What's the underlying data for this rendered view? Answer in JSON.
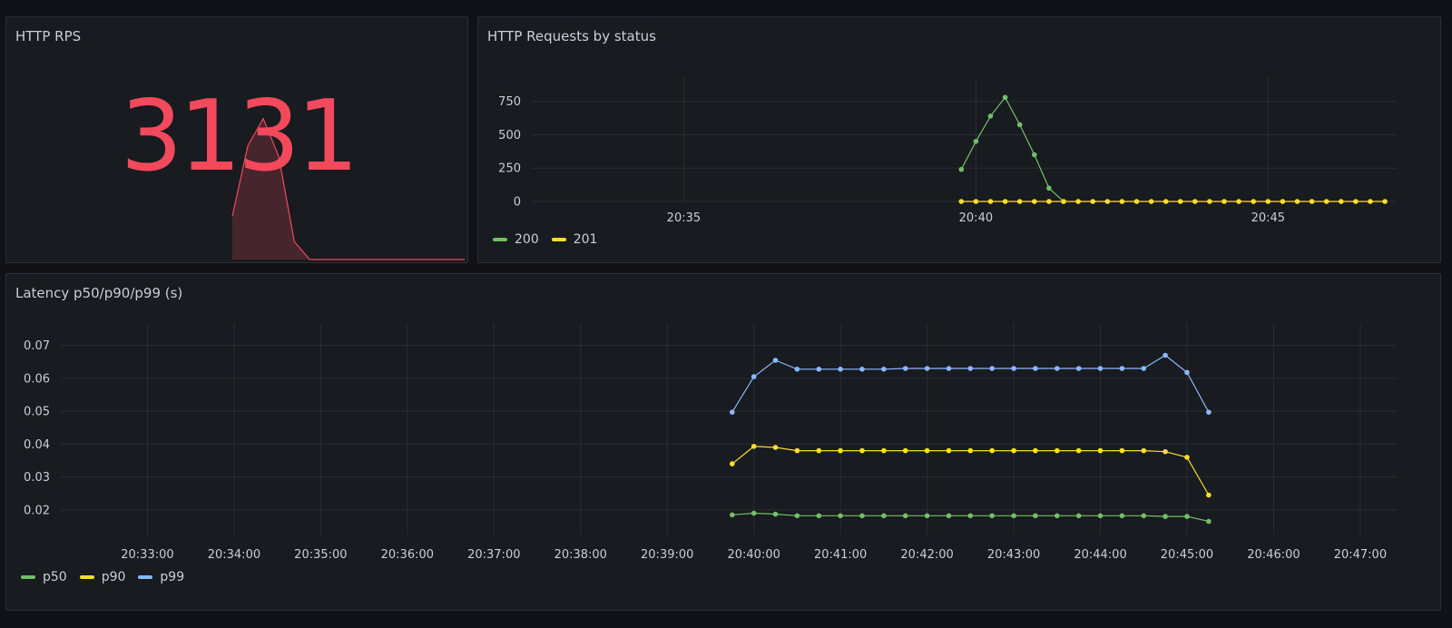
{
  "panels": {
    "rps": {
      "title": "HTTP RPS",
      "value": "3131",
      "color": "#f2495c"
    },
    "status": {
      "title": "HTTP Requests by status"
    },
    "latency": {
      "title": "Latency p50/p90/p99 (s)"
    }
  },
  "chart_data": [
    {
      "type": "area",
      "panel": "rps",
      "title": "",
      "x": [
        0,
        1,
        2,
        3,
        4,
        5,
        6,
        7,
        8,
        9,
        10,
        11,
        12,
        13,
        14,
        15
      ],
      "values": [
        240,
        630,
        780,
        570,
        100,
        0,
        0,
        0,
        0,
        0,
        0,
        0,
        0,
        0,
        0,
        0
      ],
      "ylim": [
        0,
        1050
      ],
      "color": "#f2495c"
    },
    {
      "type": "line",
      "panel": "status",
      "title": "HTTP Requests by status",
      "xticks": [
        "20:35",
        "20:40",
        "20:45"
      ],
      "xtick_minutes": [
        35,
        40,
        45
      ],
      "xlim": [
        32.4,
        47.2
      ],
      "yticks": [
        0,
        250,
        500,
        750
      ],
      "ylim": [
        0,
        850
      ],
      "grid": true,
      "legend": "bottom-left",
      "series": [
        {
          "name": "200",
          "color": "#73bf69",
          "x": [
            39.75,
            40.0,
            40.25,
            40.5,
            40.75,
            41.0,
            41.25,
            41.5
          ],
          "values": [
            240,
            450,
            640,
            780,
            575,
            350,
            100,
            0
          ]
        },
        {
          "name": "201",
          "color": "#fade2a",
          "x": [
            39.75,
            40.0,
            40.25,
            40.5,
            40.75,
            41.0,
            41.25,
            41.5,
            41.75,
            42.0,
            42.25,
            42.5,
            42.75,
            43.0,
            43.25,
            43.5,
            43.75,
            44.0,
            44.25,
            44.5,
            44.75,
            45.0,
            45.25,
            45.5,
            45.75,
            46.0,
            46.25,
            46.5,
            46.75,
            47.0
          ],
          "values": [
            0,
            0,
            0,
            0,
            0,
            0,
            0,
            0,
            0,
            0,
            0,
            0,
            0,
            0,
            0,
            0,
            0,
            0,
            0,
            0,
            0,
            0,
            0,
            0,
            0,
            0,
            0,
            0,
            0,
            0
          ]
        }
      ]
    },
    {
      "type": "line",
      "panel": "latency",
      "title": "Latency p50/p90/p99 (s)",
      "xticks": [
        "20:33:00",
        "20:34:00",
        "20:35:00",
        "20:36:00",
        "20:37:00",
        "20:38:00",
        "20:39:00",
        "20:40:00",
        "20:41:00",
        "20:42:00",
        "20:43:00",
        "20:44:00",
        "20:45:00",
        "20:46:00",
        "20:47:00"
      ],
      "xtick_minutes": [
        33,
        34,
        35,
        36,
        37,
        38,
        39,
        40,
        41,
        42,
        43,
        44,
        45,
        46,
        47
      ],
      "xlim": [
        32.0,
        47.42
      ],
      "yticks": [
        0.02,
        0.03,
        0.04,
        0.05,
        0.06,
        0.07
      ],
      "ylim": [
        0.0125,
        0.0735
      ],
      "grid": true,
      "legend": "bottom-left",
      "series": [
        {
          "name": "p50",
          "color": "#73bf69",
          "x": [
            39.75,
            40.0,
            40.25,
            40.5,
            40.75,
            41.0,
            41.25,
            41.5,
            41.75,
            42.0,
            42.25,
            42.5,
            42.75,
            43.0,
            43.25,
            43.5,
            43.75,
            44.0,
            44.25,
            44.5,
            44.75,
            45.0,
            45.25
          ],
          "values": [
            0.0185,
            0.019,
            0.0187,
            0.0182,
            0.0182,
            0.0182,
            0.0182,
            0.0182,
            0.0182,
            0.0182,
            0.0182,
            0.0182,
            0.0182,
            0.0182,
            0.0182,
            0.0182,
            0.0182,
            0.0182,
            0.0182,
            0.0182,
            0.018,
            0.018,
            0.0165
          ]
        },
        {
          "name": "p90",
          "color": "#fade2a",
          "x": [
            39.75,
            40.0,
            40.25,
            40.5,
            40.75,
            41.0,
            41.25,
            41.5,
            41.75,
            42.0,
            42.25,
            42.5,
            42.75,
            43.0,
            43.25,
            43.5,
            43.75,
            44.0,
            44.25,
            44.5,
            44.75,
            45.0,
            45.25
          ],
          "values": [
            0.034,
            0.0393,
            0.039,
            0.038,
            0.038,
            0.038,
            0.038,
            0.038,
            0.038,
            0.038,
            0.038,
            0.038,
            0.038,
            0.038,
            0.038,
            0.038,
            0.038,
            0.038,
            0.038,
            0.038,
            0.0377,
            0.036,
            0.0245
          ]
        },
        {
          "name": "p99",
          "color": "#8ab8ff",
          "x": [
            39.75,
            40.0,
            40.25,
            40.5,
            40.75,
            41.0,
            41.25,
            41.5,
            41.75,
            42.0,
            42.25,
            42.5,
            42.75,
            43.0,
            43.25,
            43.5,
            43.75,
            44.0,
            44.25,
            44.5,
            44.75,
            45.0,
            45.25
          ],
          "values": [
            0.0497,
            0.0605,
            0.0655,
            0.0628,
            0.0628,
            0.0628,
            0.0628,
            0.0628,
            0.063,
            0.063,
            0.063,
            0.063,
            0.063,
            0.063,
            0.063,
            0.063,
            0.063,
            0.063,
            0.063,
            0.063,
            0.067,
            0.0618,
            0.0497
          ]
        }
      ]
    }
  ]
}
